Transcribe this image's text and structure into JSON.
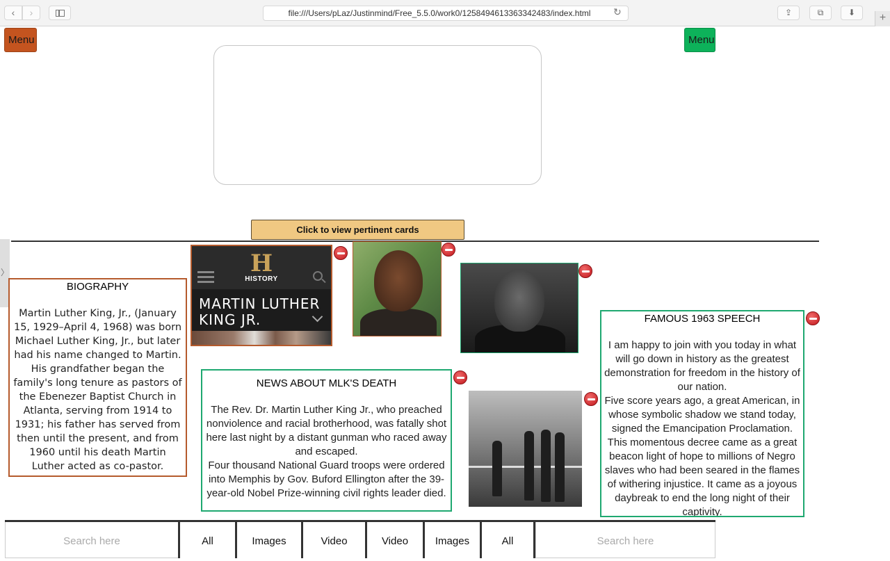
{
  "browser": {
    "url": "file:///Users/pLaz/Justinmind/Free_5.5.0/work0/1258494613363342483/index.html",
    "back_icon": "‹",
    "forward_icon": "›",
    "reload_icon": "↻",
    "share_icon": "⇪",
    "tabs_icon": "⧉",
    "download_icon": "⬇",
    "newtab_icon": "+"
  },
  "header": {
    "menu_left_label": "Menu",
    "menu_right_label": "Menu",
    "cta_label": "Click to view pertinent cards",
    "side_tab_icon": "〉"
  },
  "colors": {
    "menu_left": "#c4541f",
    "menu_right": "#0db25a",
    "cta": "#f0c882",
    "card_border_orange": "#b55a2c",
    "card_border_green": "#1ea870"
  },
  "cards": {
    "biography": {
      "title": "BIOGRAPHY",
      "body": "Martin Luther King, Jr., (January 15, 1929–April 4, 1968) was born Michael Luther King, Jr., but later had his name changed to Martin. His grandfather began the family's long tenure as pastors of the Ebenezer Baptist Church in Atlanta, serving from 1914 to 1931; his father has served from then until the present, and from 1960 until his death Martin Luther acted as co-pastor."
    },
    "history": {
      "logo_letter": "H",
      "logo_word": "HISTORY",
      "name_line1": "MARTIN LUTHER",
      "name_line2": "KING JR."
    },
    "news": {
      "title": "NEWS ABOUT MLK'S DEATH",
      "body_p1": "The Rev. Dr. Martin Luther King Jr., who preached nonviolence and racial brotherhood, was fatally shot here last night by a distant gunman who raced away and escaped.",
      "body_p2": "Four thousand National Guard troops were ordered into Memphis by Gov. Buford Ellington after the 39-year-old Nobel Prize-winning civil rights leader died."
    },
    "speech": {
      "title": "FAMOUS 1963 SPEECH",
      "body_p1": "I am happy to join with you today in what will go down in history as the greatest demonstration for freedom in the history of our nation.",
      "body_p2": "Five score years ago, a great American, in whose symbolic shadow we stand today, signed the Emancipation Proclamation. This momentous decree came as a great beacon light of hope to millions of Negro slaves who had been seared in the flames of withering injustice. It came as a joyous daybreak to end the long night of their captivity."
    }
  },
  "toolbar": {
    "search_left_placeholder": "Search here",
    "search_right_placeholder": "Search here",
    "left_buttons": [
      "All",
      "Images",
      "Video"
    ],
    "right_buttons": [
      "Video",
      "Images",
      "All"
    ]
  }
}
